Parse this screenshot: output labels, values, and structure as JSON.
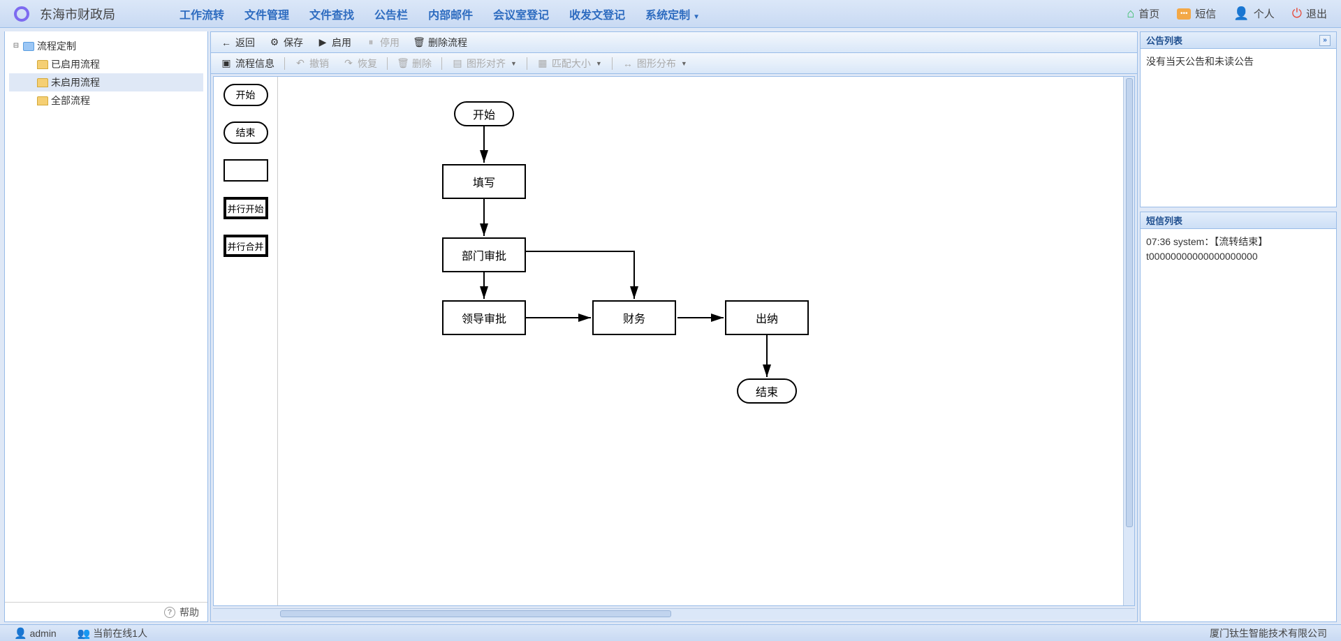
{
  "app": {
    "title": "东海市财政局"
  },
  "nav": {
    "items": [
      "工作流转",
      "文件管理",
      "文件查找",
      "公告栏",
      "内部邮件",
      "会议室登记",
      "收发文登记",
      "系统定制"
    ]
  },
  "header_right": {
    "home": "首页",
    "sms": "短信",
    "person": "个人",
    "logout": "退出"
  },
  "tree": {
    "root": "流程定制",
    "c1": "已启用流程",
    "c2": "未启用流程",
    "c3": "全部流程"
  },
  "left_footer": {
    "help": "帮助"
  },
  "toolbar1": {
    "back": "返回",
    "save": "保存",
    "enable": "启用",
    "disable": "停用",
    "del": "删除流程"
  },
  "toolbar2": {
    "info": "流程信息",
    "undo": "撤销",
    "redo": "恢复",
    "del": "删除",
    "align": "图形对齐",
    "size": "匹配大小",
    "dist": "图形分布"
  },
  "stencil": {
    "start": "开始",
    "end": "结束",
    "pstart": "并行开始",
    "pmerge": "并行合并"
  },
  "flow": {
    "n1": "开始",
    "n2": "填写",
    "n3": "部门审批",
    "n4": "领导审批",
    "n5": "财务",
    "n6": "出纳",
    "n7": "结束"
  },
  "right": {
    "hdr1": "公告列表",
    "body1": "没有当天公告和未读公告",
    "hdr2": "短信列表",
    "body2a": "07:36 system：【流转结束】",
    "body2b": "t00000000000000000000"
  },
  "status": {
    "user": "admin",
    "online": "当前在线1人",
    "company": "厦门钛生智能技术有限公司"
  }
}
